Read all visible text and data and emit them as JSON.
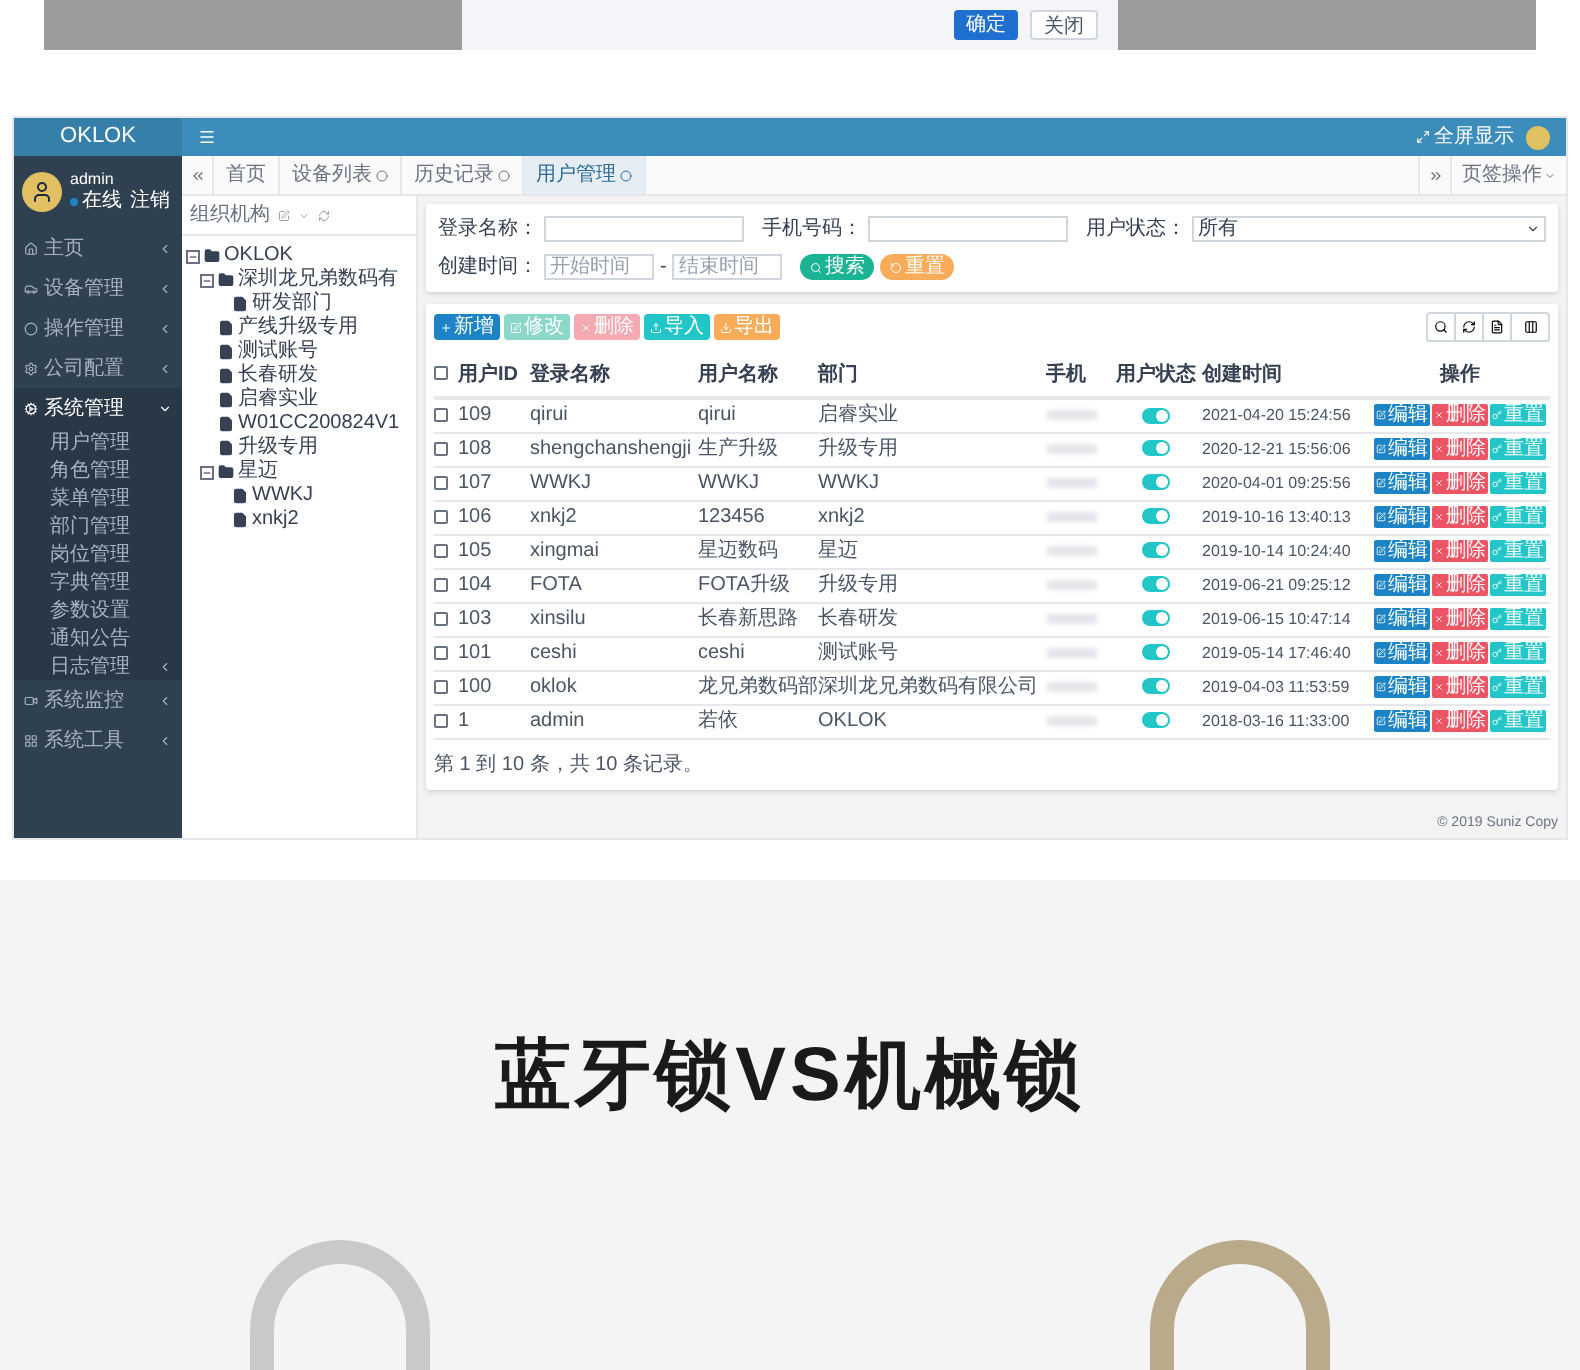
{
  "dialog": {
    "buttons": [
      {
        "label": "确定",
        "primary": true
      },
      {
        "label": "关闭",
        "primary": false
      }
    ]
  },
  "admin": {
    "brand": "OKLOK",
    "fullscreen": "全屏显示",
    "user": {
      "name": "admin",
      "status": "在线",
      "logout": "注销"
    },
    "sidebar": [
      {
        "label": "主页",
        "expanded": false
      },
      {
        "label": "设备管理",
        "expanded": false
      },
      {
        "label": "操作管理",
        "expanded": false
      },
      {
        "label": "公司配置",
        "expanded": false
      },
      {
        "label": "系统管理",
        "expanded": true,
        "children": [
          {
            "label": "用户管理",
            "has_submenu": false
          },
          {
            "label": "角色管理",
            "has_submenu": false
          },
          {
            "label": "菜单管理",
            "has_submenu": false
          },
          {
            "label": "部门管理",
            "has_submenu": false
          },
          {
            "label": "岗位管理",
            "has_submenu": false
          },
          {
            "label": "字典管理",
            "has_submenu": false
          },
          {
            "label": "参数设置",
            "has_submenu": false
          },
          {
            "label": "通知公告",
            "has_submenu": false
          },
          {
            "label": "日志管理",
            "has_submenu": true
          }
        ]
      },
      {
        "label": "系统监控",
        "expanded": false
      },
      {
        "label": "系统工具",
        "expanded": false
      }
    ],
    "tabs": [
      {
        "label": "首页",
        "selected": false,
        "closable": false
      },
      {
        "label": "设备列表",
        "selected": false,
        "closable": true
      },
      {
        "label": "历史记录",
        "selected": false,
        "closable": true
      },
      {
        "label": "用户管理",
        "selected": true,
        "closable": true
      }
    ],
    "tab_actions": "页签操作",
    "tree": {
      "title": "组织机构",
      "nodes": [
        {
          "label": "OKLOK",
          "expanded": true,
          "children": [
            {
              "label": "深圳龙兄弟数码有",
              "expanded": true,
              "children": [
                {
                  "label": "研发部门"
                }
              ]
            },
            {
              "label": "产线升级专用"
            },
            {
              "label": "测试账号"
            },
            {
              "label": "长春研发"
            },
            {
              "label": "启睿实业"
            },
            {
              "label": "W01CC200824V1"
            },
            {
              "label": "升级专用"
            },
            {
              "label": "星迈",
              "expanded": true,
              "children": [
                {
                  "label": "WWKJ"
                },
                {
                  "label": "xnkj2"
                }
              ]
            }
          ]
        }
      ]
    },
    "search": {
      "login_label": "登录名称：",
      "phone_label": "手机号码：",
      "status_label": "用户状态：",
      "status_value": "所有",
      "time_label": "创建时间：",
      "start_placeholder": "开始时间",
      "separator": "-",
      "end_placeholder": "结束时间",
      "search_button": "搜索",
      "reset_button": "重置"
    },
    "toolbar": [
      {
        "kind": "add",
        "label": "新增",
        "disabled": false
      },
      {
        "kind": "edit",
        "label": "修改",
        "disabled": true
      },
      {
        "kind": "remove",
        "label": "删除",
        "disabled": true
      },
      {
        "kind": "import",
        "label": "导入",
        "disabled": false
      },
      {
        "kind": "export",
        "label": "导出",
        "disabled": false
      }
    ],
    "table": {
      "all_checked": false,
      "columns": [
        "用户ID",
        "登录名称",
        "用户名称",
        "部门",
        "手机",
        "用户状态",
        "创建时间",
        "操作"
      ],
      "rows": [
        {
          "checked": false,
          "id": "109",
          "login": "qirui",
          "name": "qirui",
          "dept": "启睿实业",
          "enabled": true,
          "created": "2021-04-20 15:24:56",
          "actions": [
            {
              "kind": "edit",
              "label": "编辑"
            },
            {
              "kind": "remove",
              "label": "删除"
            },
            {
              "kind": "reset",
              "label": "重置"
            }
          ]
        },
        {
          "checked": false,
          "id": "108",
          "login": "shengchanshengji",
          "name": "生产升级",
          "dept": "升级专用",
          "enabled": true,
          "created": "2020-12-21 15:56:06",
          "actions": [
            {
              "kind": "edit",
              "label": "编辑"
            },
            {
              "kind": "remove",
              "label": "删除"
            },
            {
              "kind": "reset",
              "label": "重置"
            }
          ]
        },
        {
          "checked": false,
          "id": "107",
          "login": "WWKJ",
          "name": "WWKJ",
          "dept": "WWKJ",
          "enabled": true,
          "created": "2020-04-01 09:25:56",
          "actions": [
            {
              "kind": "edit",
              "label": "编辑"
            },
            {
              "kind": "remove",
              "label": "删除"
            },
            {
              "kind": "reset",
              "label": "重置"
            }
          ]
        },
        {
          "checked": false,
          "id": "106",
          "login": "xnkj2",
          "name": "123456",
          "dept": "xnkj2",
          "enabled": true,
          "created": "2019-10-16 13:40:13",
          "actions": [
            {
              "kind": "edit",
              "label": "编辑"
            },
            {
              "kind": "remove",
              "label": "删除"
            },
            {
              "kind": "reset",
              "label": "重置"
            }
          ]
        },
        {
          "checked": false,
          "id": "105",
          "login": "xingmai",
          "name": "星迈数码",
          "dept": "星迈",
          "enabled": true,
          "created": "2019-10-14 10:24:40",
          "actions": [
            {
              "kind": "edit",
              "label": "编辑"
            },
            {
              "kind": "remove",
              "label": "删除"
            },
            {
              "kind": "reset",
              "label": "重置"
            }
          ]
        },
        {
          "checked": false,
          "id": "104",
          "login": "FOTA",
          "name": "FOTA升级",
          "dept": "升级专用",
          "enabled": true,
          "created": "2019-06-21 09:25:12",
          "actions": [
            {
              "kind": "edit",
              "label": "编辑"
            },
            {
              "kind": "remove",
              "label": "删除"
            },
            {
              "kind": "reset",
              "label": "重置"
            }
          ]
        },
        {
          "checked": false,
          "id": "103",
          "login": "xinsilu",
          "name": "长春新思路",
          "dept": "长春研发",
          "enabled": true,
          "created": "2019-06-15 10:47:14",
          "actions": [
            {
              "kind": "edit",
              "label": "编辑"
            },
            {
              "kind": "remove",
              "label": "删除"
            },
            {
              "kind": "reset",
              "label": "重置"
            }
          ]
        },
        {
          "checked": false,
          "id": "101",
          "login": "ceshi",
          "name": "ceshi",
          "dept": "测试账号",
          "enabled": true,
          "created": "2019-05-14 17:46:40",
          "actions": [
            {
              "kind": "edit",
              "label": "编辑"
            },
            {
              "kind": "remove",
              "label": "删除"
            },
            {
              "kind": "reset",
              "label": "重置"
            }
          ]
        },
        {
          "checked": false,
          "id": "100",
          "login": "oklok",
          "name": "龙兄弟数码部",
          "dept": "深圳龙兄弟数码有限公司",
          "enabled": true,
          "created": "2019-04-03 11:53:59",
          "actions": [
            {
              "kind": "edit",
              "label": "编辑"
            },
            {
              "kind": "remove",
              "label": "删除"
            },
            {
              "kind": "reset",
              "label": "重置"
            }
          ]
        },
        {
          "checked": false,
          "id": "1",
          "login": "admin",
          "name": "若依",
          "dept": "OKLOK",
          "enabled": true,
          "created": "2018-03-16 11:33:00",
          "actions": [
            {
              "kind": "edit",
              "label": "编辑"
            },
            {
              "kind": "remove",
              "label": "删除"
            },
            {
              "kind": "reset",
              "label": "重置"
            }
          ]
        }
      ],
      "pagination": "第 1 到 10 条，共 10 条记录。"
    },
    "footer": "© 2019 Suniz Copy"
  },
  "section_title": "蓝牙锁VS机械锁"
}
